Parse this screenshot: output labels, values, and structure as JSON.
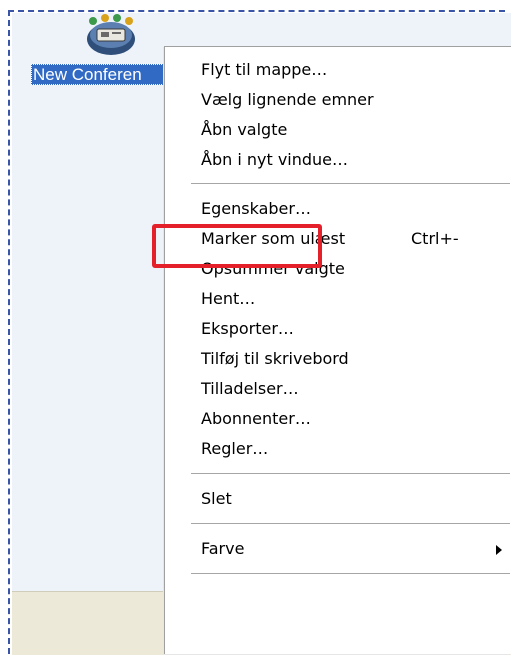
{
  "item": {
    "label": "New Conferen",
    "icon": "conference-room-icon"
  },
  "menu": {
    "items": [
      {
        "label": "Flyt til mappe…"
      },
      {
        "label": "Vælg lignende emner"
      },
      {
        "label": "Åbn valgte"
      },
      {
        "label": "Åbn i nyt vindue…"
      },
      {
        "label": "Egenskaber…",
        "highlighted": true
      },
      {
        "label": "Marker som ulæst",
        "shortcut": "Ctrl+-"
      },
      {
        "label": "Opsummer valgte"
      },
      {
        "label": "Hent…"
      },
      {
        "label": "Eksporter…"
      },
      {
        "label": "Tilføj til skrivebord"
      },
      {
        "label": "Tilladelser…"
      },
      {
        "label": "Abonnenter…"
      },
      {
        "label": "Regler…"
      },
      {
        "label": "Slet"
      },
      {
        "label": "Farve",
        "submenu": true
      }
    ]
  },
  "colors": {
    "selection": "#316ac5",
    "highlight_box": "#e4202a",
    "panel_background": "#eef3fa"
  }
}
